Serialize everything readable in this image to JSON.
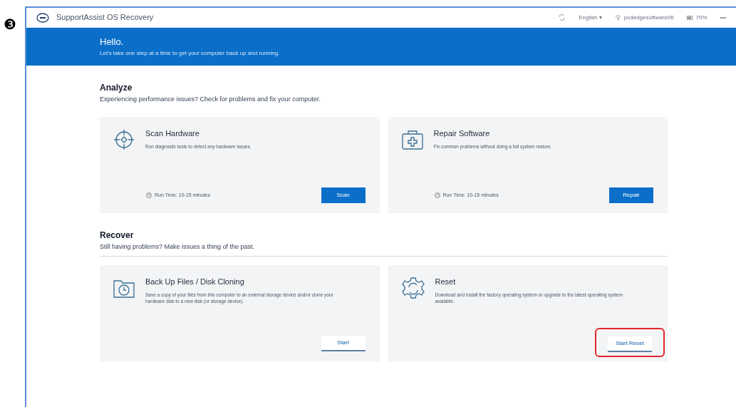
{
  "step_marker": "❸",
  "app": {
    "title": "SupportAssist OS Recovery",
    "language": "English ▾",
    "network": "pcdedgesoftware06",
    "battery": "70%",
    "more": "•••"
  },
  "banner": {
    "title": "Hello.",
    "subtitle": "Let's take one step at a time to get your computer back up and running."
  },
  "sections": [
    {
      "title": "Analyze",
      "subtitle": "Experiencing performance issues? Check for problems and fix your computer.",
      "divider": false,
      "cards": [
        {
          "title": "Scan Hardware",
          "description": "Run diagnostic tests to detect any hardware issues.",
          "run_time": "Run Time: 10-15 minutes",
          "button": {
            "label": "Scan",
            "kind": "primary",
            "highlighted": false
          }
        },
        {
          "title": "Repair Software",
          "description": "Fix common problems without doing a full system restore.",
          "run_time": "Run Time: 10-15 minutes",
          "button": {
            "label": "Repair",
            "kind": "primary",
            "highlighted": false
          }
        }
      ]
    },
    {
      "title": "Recover",
      "subtitle": "Still having problems? Make issues a thing of the past.",
      "divider": true,
      "cards": [
        {
          "title": "Back Up Files / Disk Cloning",
          "description": "Save a copy of your files from this computer to an external storage device and/or clone your hardware disk to a new disk (or storage device).",
          "button": {
            "label": "Start",
            "kind": "secondary",
            "highlighted": false
          }
        },
        {
          "title": "Reset",
          "description": "Download and install the factory operating system or upgrade to the latest operating system available.",
          "button": {
            "label": "Start Reset",
            "kind": "secondary",
            "highlighted": true
          }
        }
      ]
    }
  ]
}
